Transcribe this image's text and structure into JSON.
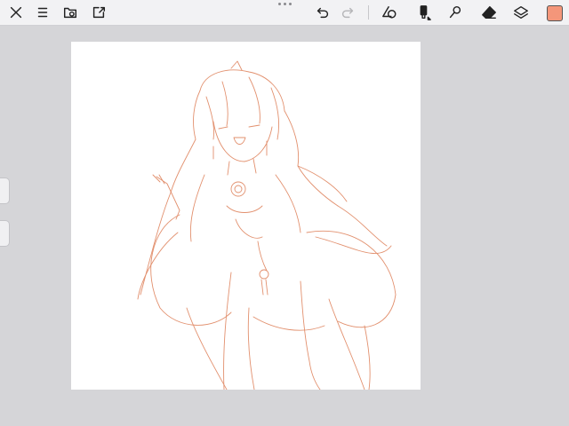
{
  "toolbar": {
    "left_icons": [
      "close-icon",
      "menu-icon",
      "import-folder-icon",
      "export-share-icon"
    ],
    "center_icons": [
      "undo-icon",
      "redo-icon"
    ],
    "tool_icons": [
      "shape-tool-icon",
      "brush-tool-icon",
      "smudge-tool-icon",
      "eraser-tool-icon",
      "layers-icon"
    ],
    "redo_enabled": false
  },
  "current_color": "#f4967a",
  "accent_stroke_color": "#e2906e",
  "canvas_background": "#ffffff",
  "workspace_background": "#d5d5d8"
}
